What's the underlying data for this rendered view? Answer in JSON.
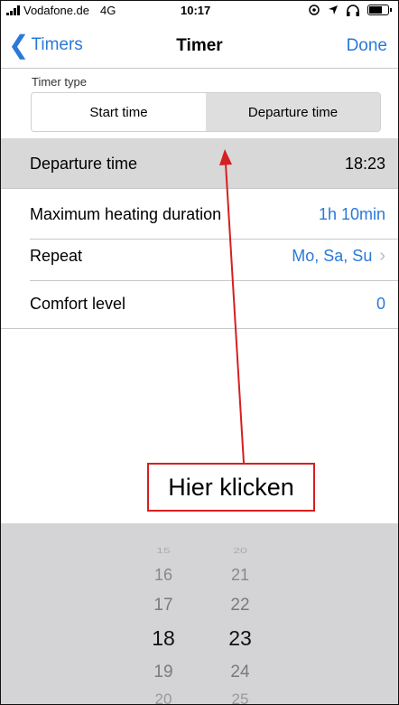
{
  "status_bar": {
    "carrier": "Vodafone.de",
    "network": "4G",
    "time": "10:17",
    "icons": [
      "signal-icon",
      "location-icon",
      "headphones-icon",
      "battery-icon"
    ]
  },
  "nav": {
    "back_label": "Timers",
    "title": "Timer",
    "done_label": "Done"
  },
  "timer_type": {
    "label": "Timer type",
    "options": [
      "Start time",
      "Departure time"
    ],
    "selected": "Departure time"
  },
  "settings": [
    {
      "label": "Departure time",
      "value": "18:23",
      "selected": true
    },
    {
      "label": "Maximum heating duration",
      "value": "1h 10min"
    },
    {
      "label": "Repeat",
      "value": "Mo, Sa, Su"
    },
    {
      "label": "Comfort level",
      "value": "0"
    }
  ],
  "picker": {
    "hours": [
      "15",
      "16",
      "17",
      "18",
      "19",
      "20"
    ],
    "minutes": [
      "20",
      "21",
      "22",
      "23",
      "24",
      "25"
    ],
    "selected_hour": "18",
    "selected_minute": "23"
  },
  "annotation": {
    "text": "Hier klicken"
  },
  "colors": {
    "accent": "#2a79d8",
    "selected_row": "#d8d8d8",
    "picker_bg": "#d4d4d6",
    "annotation_red": "#d61f1f"
  }
}
